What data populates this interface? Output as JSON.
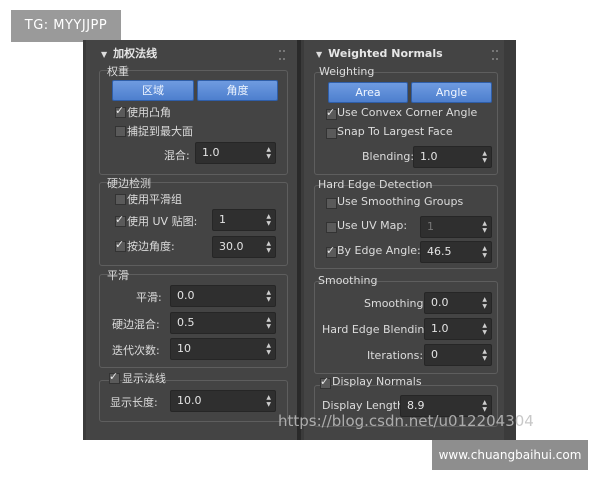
{
  "watermark_tag": "TG: MYYJJPP",
  "watermark_url": "https://blog.csdn.net/u012204304",
  "watermark_site": "www.chuangbaihui.com",
  "left_panel": {
    "rollout_title": "加权法线",
    "weighting": {
      "title": "权重",
      "btn_area": "区域",
      "btn_angle": "角度",
      "use_convex": "使用凸角",
      "snap_largest": "捕捉到最大面",
      "blending_label": "混合:",
      "blending_value": "1.0"
    },
    "hard_edge": {
      "title": "硬边检测",
      "use_smoothing": "使用平滑组",
      "use_uv": "使用 UV 贴图:",
      "uv_value": "1",
      "by_angle": "按边角度:",
      "angle_value": "30.0"
    },
    "smoothing": {
      "title": "平滑",
      "smooth_label": "平滑:",
      "smooth_value": "0.0",
      "hard_blend_label": "硬边混合:",
      "hard_blend_value": "0.5",
      "iter_label": "迭代次数:",
      "iter_value": "10"
    },
    "display": {
      "title": "显示法线",
      "length_label": "显示长度:",
      "length_value": "10.0"
    }
  },
  "right_panel": {
    "rollout_title": "Weighted Normals",
    "weighting": {
      "title": "Weighting",
      "btn_area": "Area",
      "btn_angle": "Angle",
      "use_convex": "Use Convex Corner Angle",
      "snap_largest": "Snap To Largest Face",
      "blending_label": "Blending:",
      "blending_value": "1.0"
    },
    "hard_edge": {
      "title": "Hard Edge Detection",
      "use_smoothing": "Use Smoothing Groups",
      "use_uv": "Use UV Map:",
      "uv_value": "1",
      "by_angle": "By Edge Angle:",
      "angle_value": "46.5"
    },
    "smoothing": {
      "title": "Smoothing",
      "smooth_label": "Smoothing:",
      "smooth_value": "0.0",
      "hard_blend_label": "Hard Edge Blending:",
      "hard_blend_value": "1.0",
      "iter_label": "Iterations:",
      "iter_value": "0"
    },
    "display": {
      "title": "Display Normals",
      "length_label": "Display Length:",
      "length_value": "8.9"
    }
  }
}
